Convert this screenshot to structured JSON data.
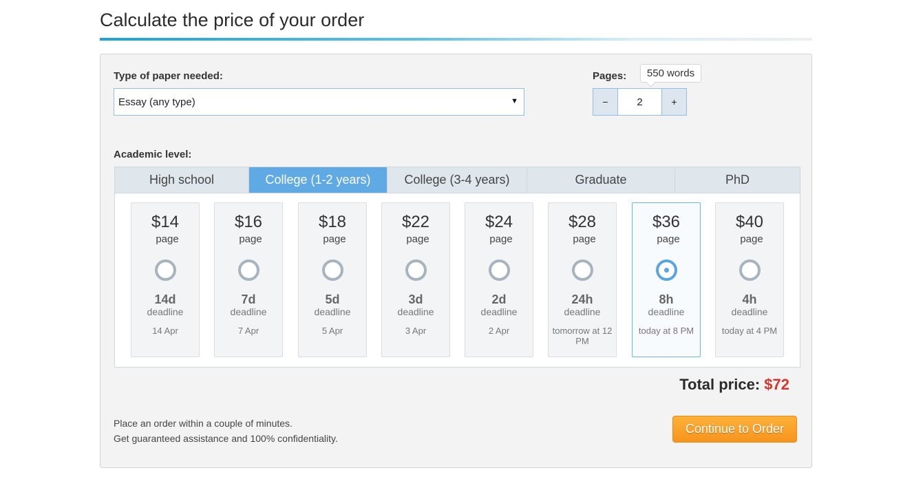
{
  "heading": "Calculate the price of your order",
  "paper": {
    "label": "Type of paper needed:",
    "selected": "Essay (any type)",
    "caret": "▼"
  },
  "pages": {
    "label": "Pages:",
    "value": "2",
    "minus": "−",
    "plus": "+",
    "words_tooltip": "550 words"
  },
  "academic": {
    "label": "Academic level:",
    "tabs": [
      {
        "label": "High school",
        "active": false
      },
      {
        "label": "College (1-2 years)",
        "active": true
      },
      {
        "label": "College (3-4 years)",
        "active": false
      },
      {
        "label": "Graduate",
        "active": false
      },
      {
        "label": "PhD",
        "active": false
      }
    ]
  },
  "deadlines": [
    {
      "price": "$14",
      "per": "page",
      "duration": "14d",
      "deadline_label": "deadline",
      "date": "14 Apr",
      "selected": false
    },
    {
      "price": "$16",
      "per": "page",
      "duration": "7d",
      "deadline_label": "deadline",
      "date": "7 Apr",
      "selected": false
    },
    {
      "price": "$18",
      "per": "page",
      "duration": "5d",
      "deadline_label": "deadline",
      "date": "5 Apr",
      "selected": false
    },
    {
      "price": "$22",
      "per": "page",
      "duration": "3d",
      "deadline_label": "deadline",
      "date": "3 Apr",
      "selected": false
    },
    {
      "price": "$24",
      "per": "page",
      "duration": "2d",
      "deadline_label": "deadline",
      "date": "2 Apr",
      "selected": false
    },
    {
      "price": "$28",
      "per": "page",
      "duration": "24h",
      "deadline_label": "deadline",
      "date": "tomorrow at 12 PM",
      "selected": false
    },
    {
      "price": "$36",
      "per": "page",
      "duration": "8h",
      "deadline_label": "deadline",
      "date": "today at 8 PM",
      "selected": true
    },
    {
      "price": "$40",
      "per": "page",
      "duration": "4h",
      "deadline_label": "deadline",
      "date": "today at 4 PM",
      "selected": false
    }
  ],
  "total": {
    "label": "Total price:",
    "amount": "$72"
  },
  "notes": {
    "line1": "Place an order within a couple of minutes.",
    "line2": "Get guaranteed assistance and 100% confidentiality."
  },
  "cta_label": "Continue to Order",
  "colors": {
    "accent": "#5fa9e4",
    "price_red": "#d9342b",
    "cta_orange": "#f7941d"
  }
}
